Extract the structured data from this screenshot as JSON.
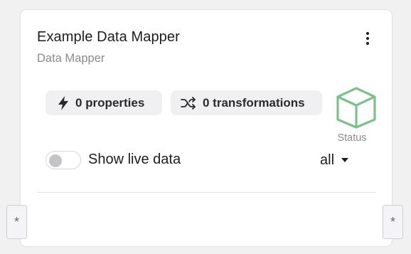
{
  "node": {
    "title": "Example Data Mapper",
    "subtitle": "Data Mapper",
    "menu_icon": "vertical-ellipsis-icon"
  },
  "chips": {
    "properties": {
      "label": "0 properties",
      "icon": "lightning-bolt-icon"
    },
    "transformations": {
      "label": "0 transformations",
      "icon": "shuffle-icon"
    }
  },
  "status": {
    "label": "Status",
    "icon": "cube-icon",
    "color": "#7cc08a"
  },
  "live_data": {
    "label": "Show live data",
    "enabled": false
  },
  "filter": {
    "value": "all"
  },
  "ports": {
    "left_label": "*",
    "right_label": "*"
  }
}
